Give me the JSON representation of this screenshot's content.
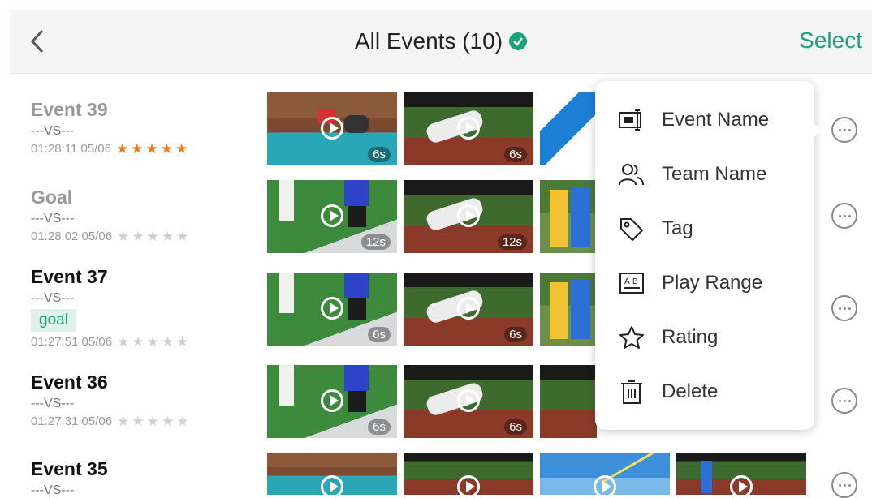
{
  "header": {
    "title": "All Events (10)",
    "select_label": "Select"
  },
  "events": [
    {
      "name": "Event 39",
      "vs": "---VS---",
      "time": "01:28:11 05/06",
      "rating": 5,
      "tag": ""
    },
    {
      "name": "Goal",
      "vs": "---VS---",
      "time": "01:28:02 05/06",
      "rating": 0,
      "tag": ""
    },
    {
      "name": "Event 37",
      "vs": "---VS---",
      "time": "01:27:51 05/06",
      "rating": 0,
      "tag": "goal"
    },
    {
      "name": "Event 36",
      "vs": "---VS---",
      "time": "01:27:31 05/06",
      "rating": 0,
      "tag": ""
    },
    {
      "name": "Event 35",
      "vs": "---VS---",
      "time": "",
      "rating": 0,
      "tag": ""
    }
  ],
  "clip_durations": {
    "row1": [
      "6s",
      "6s"
    ],
    "row2": [
      "12s",
      "12s"
    ],
    "row3": [
      "6s",
      "6s"
    ],
    "row4": [
      "6s",
      "6s"
    ]
  },
  "menu": {
    "items": [
      {
        "label": "Event Name",
        "icon": "event-name-icon"
      },
      {
        "label": "Team Name",
        "icon": "team-icon"
      },
      {
        "label": "Tag",
        "icon": "tag-icon"
      },
      {
        "label": "Play Range",
        "icon": "play-range-icon"
      },
      {
        "label": "Rating",
        "icon": "star-outline-icon"
      },
      {
        "label": "Delete",
        "icon": "trash-icon"
      }
    ]
  },
  "colors": {
    "accent": "#1aa37a",
    "star_on": "#f07a1a",
    "star_off": "#cfcfcf"
  },
  "star_glyph": "★"
}
